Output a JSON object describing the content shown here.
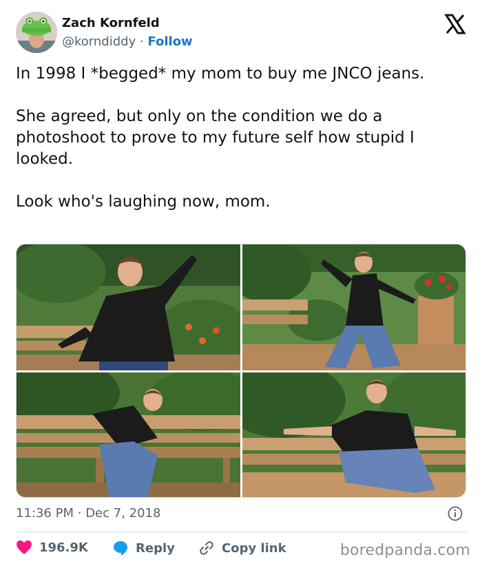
{
  "author": {
    "name": "Zach Kornfeld",
    "handle": "@korndiddy",
    "separator": "·",
    "follow_label": "Follow"
  },
  "tweet": {
    "paragraphs": [
      "In 1998 I *begged* my mom to buy me JNCO jeans.",
      "She agreed, but only on the condition we do a photoshoot to prove to my future self how stupid I looked.",
      "Look who's laughing now, mom."
    ]
  },
  "meta": {
    "time": "11:36 PM",
    "separator": "·",
    "date": "Dec 7, 2018"
  },
  "actions": {
    "likes_count": "196.9K",
    "reply_label": "Reply",
    "copy_link_label": "Copy link"
  },
  "watermark": "boredpanda.com",
  "colors": {
    "follow": "#1d74c8",
    "like": "#f91880",
    "reply": "#1d9bf0",
    "muted": "#536471"
  },
  "icons": [
    "x-logo-icon",
    "info-icon",
    "heart-icon",
    "reply-bubble-icon",
    "link-icon"
  ]
}
